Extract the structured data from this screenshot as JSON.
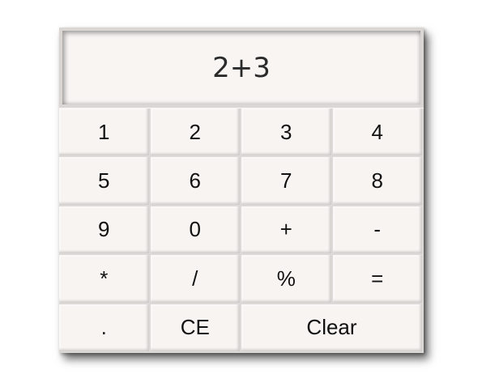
{
  "display": {
    "value": "2+3"
  },
  "keys": [
    {
      "label": "1",
      "name": "key-1"
    },
    {
      "label": "2",
      "name": "key-2"
    },
    {
      "label": "3",
      "name": "key-3"
    },
    {
      "label": "4",
      "name": "key-4"
    },
    {
      "label": "5",
      "name": "key-5"
    },
    {
      "label": "6",
      "name": "key-6"
    },
    {
      "label": "7",
      "name": "key-7"
    },
    {
      "label": "8",
      "name": "key-8"
    },
    {
      "label": "9",
      "name": "key-9"
    },
    {
      "label": "0",
      "name": "key-0"
    },
    {
      "label": "+",
      "name": "key-plus"
    },
    {
      "label": "-",
      "name": "key-minus"
    },
    {
      "label": "*",
      "name": "key-multiply"
    },
    {
      "label": "/",
      "name": "key-divide"
    },
    {
      "label": "%",
      "name": "key-percent"
    },
    {
      "label": "=",
      "name": "key-equals"
    },
    {
      "label": ".",
      "name": "key-decimal"
    },
    {
      "label": "CE",
      "name": "key-clear-entry"
    },
    {
      "label": "Clear",
      "name": "key-clear"
    }
  ]
}
